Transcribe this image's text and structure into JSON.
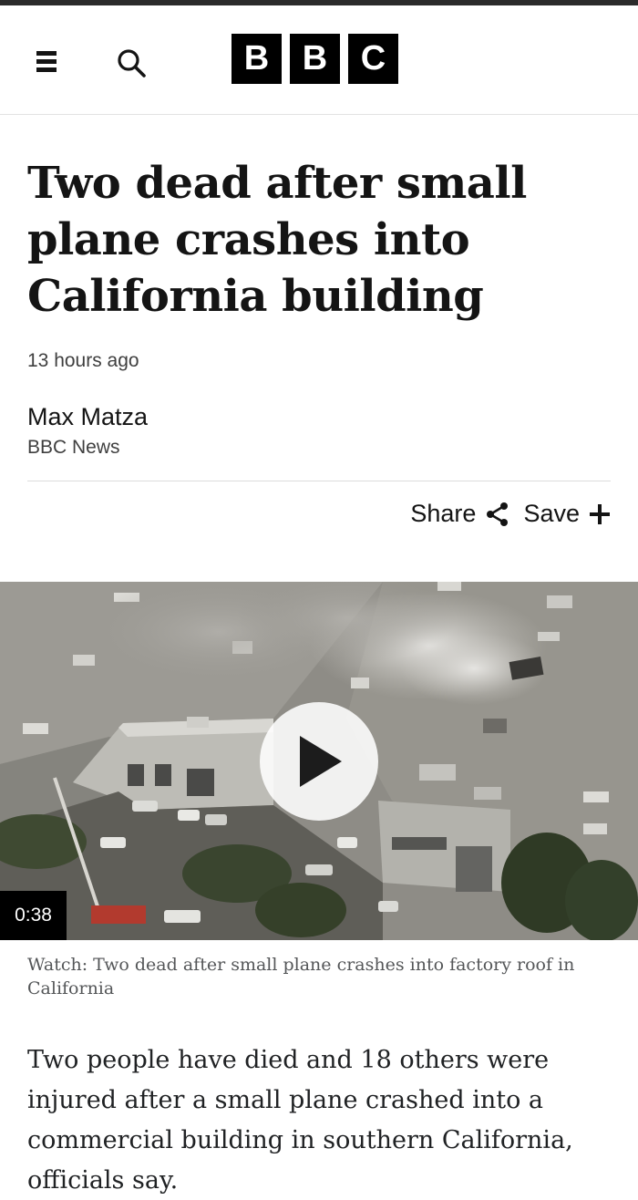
{
  "header": {
    "menu_icon": "hamburger-menu-icon",
    "search_icon": "search-icon",
    "logo_letters": [
      "B",
      "B",
      "C"
    ]
  },
  "article": {
    "headline": "Two dead after small plane crashes into California building",
    "timestamp": "13 hours ago",
    "author": {
      "name": "Max Matza",
      "organization": "BBC News"
    },
    "actions": {
      "share_label": "Share",
      "share_icon": "share-icon",
      "save_label": "Save",
      "save_icon": "plus-icon"
    },
    "video": {
      "duration": "0:38",
      "play_icon": "play-icon",
      "caption": "Watch: Two dead after small plane crashes into factory roof in California"
    },
    "body_paragraph": "Two people have died and 18 others were injured after a small plane crashed into a commercial building in southern California, officials say."
  },
  "colors": {
    "logo_background": "#000000",
    "text_primary": "#141414",
    "text_secondary": "#3f3f3f",
    "caption_text": "#545658"
  }
}
